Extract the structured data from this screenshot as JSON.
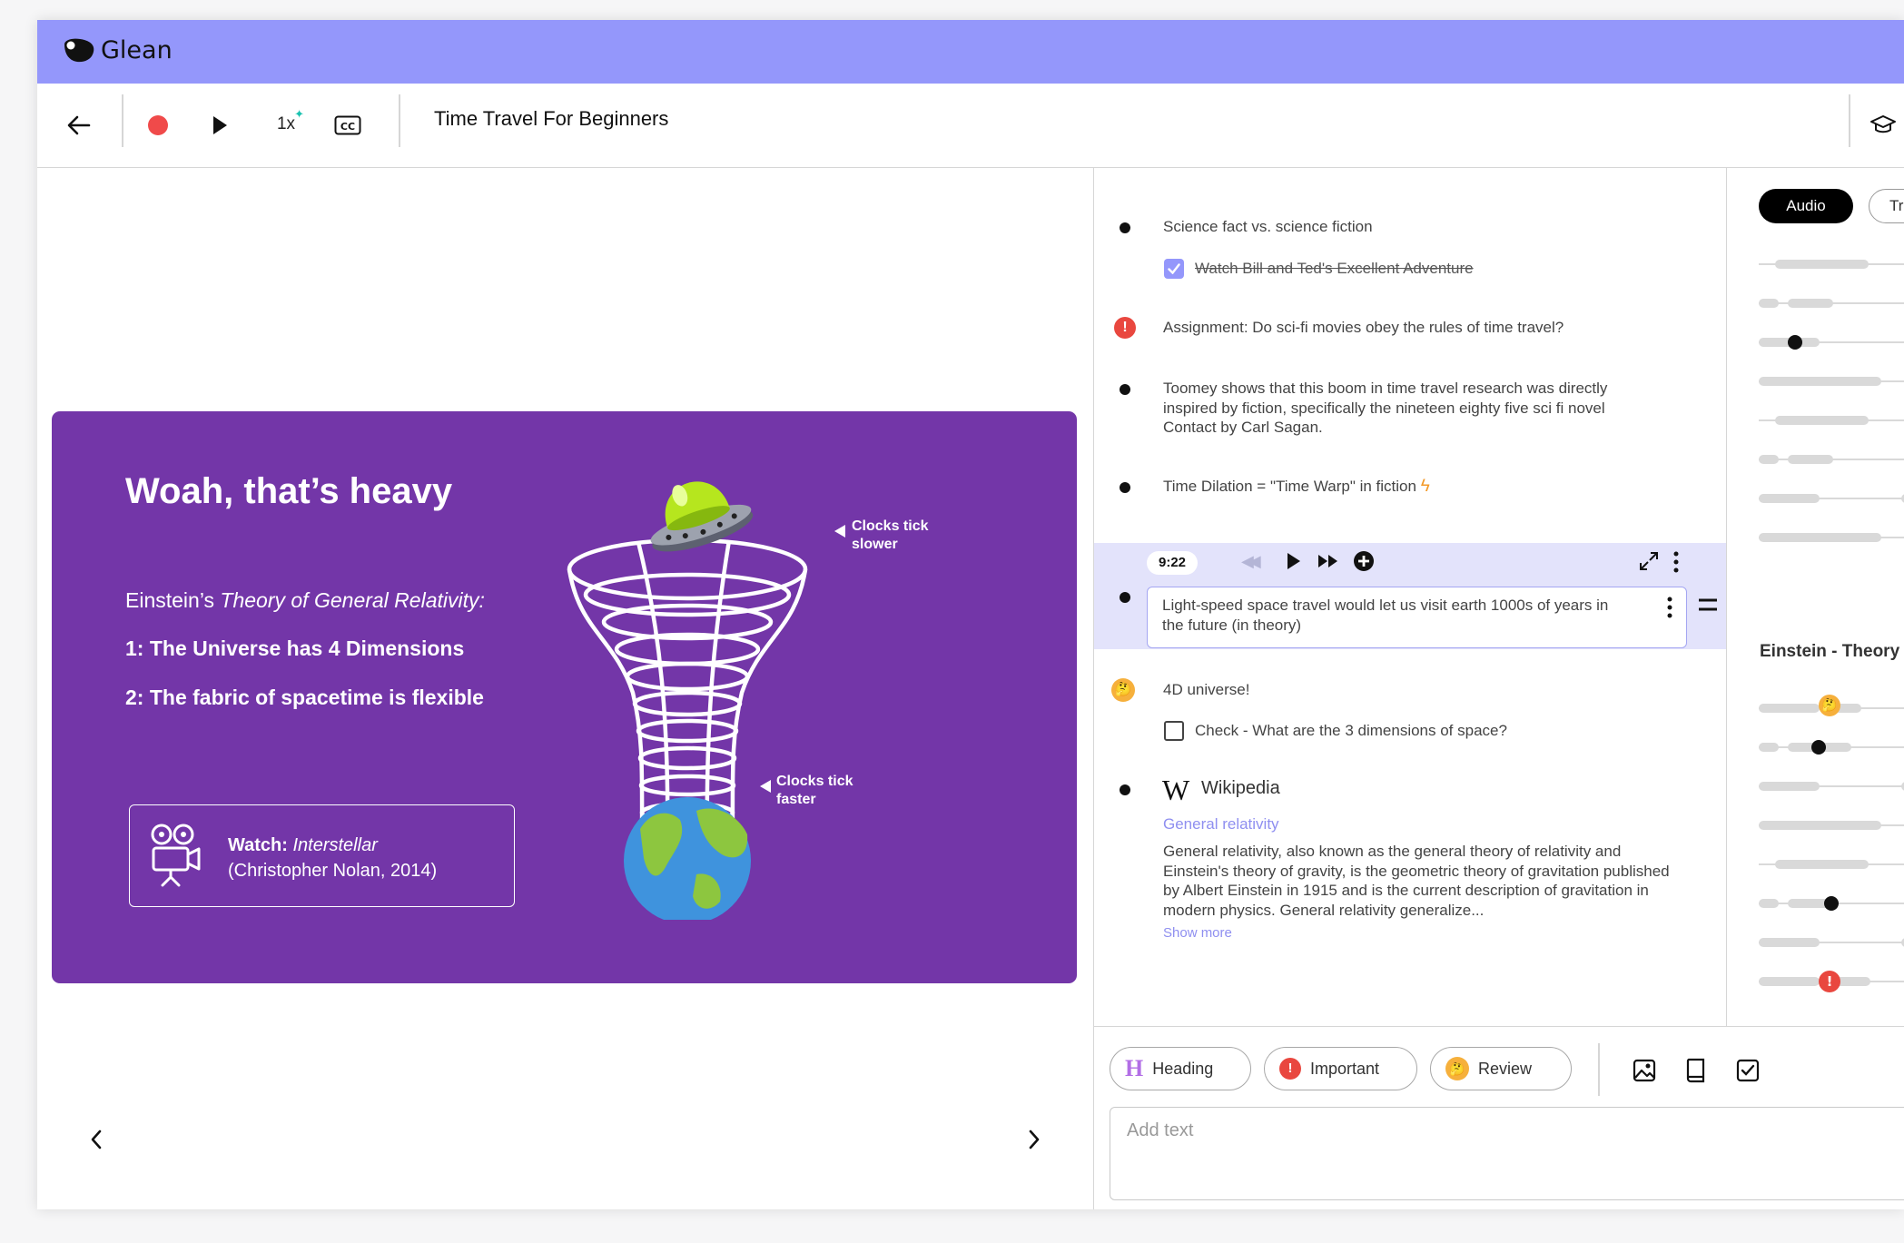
{
  "app": {
    "name": "Glean"
  },
  "toolbar": {
    "title": "Time Travel For Beginners",
    "speed": "1x",
    "cc": "CC"
  },
  "slide": {
    "title": "Woah, that’s heavy",
    "subtitle_prefix": "Einstein’s ",
    "subtitle_em": "Theory of General Relativity:",
    "point1": "1: The Universe has 4 Dimensions",
    "point2": "2: The fabric of spacetime is flexible",
    "watch_label": "Watch: ",
    "watch_title": "Interstellar",
    "watch_meta": "(Christopher Nolan, 2014)",
    "clocks_slower_1": "Clocks tick",
    "clocks_slower_2": "slower",
    "clocks_faster_1": "Clocks tick",
    "clocks_faster_2": "faster"
  },
  "notes": {
    "n1": "Science fact vs. science fiction",
    "n1_task": "Watch Bill and Ted's Excellent Adventure",
    "n2": "Assignment: Do sci-fi movies obey the rules of time travel?",
    "n3": "Toomey shows that this boom in time travel research was directly inspired by fiction, specifically the nineteen eighty five sci fi novel Contact by Carl Sagan.",
    "n4": "Time Dilation = \"Time Warp\" in fiction",
    "active_time": "9:22",
    "active_text": "Light-speed space travel would let us visit earth 1000s of years in the future (in theory)",
    "n6": "4D universe!",
    "n6_task": "Check - What are the 3 dimensions of space?",
    "wiki_source": "Wikipedia",
    "wiki_link": "General relativity",
    "wiki_text": "General relativity, also known as the general theory of relativity and Einstein's theory of gravity, is the geometric theory of gravitation published by Albert Einstein in 1915 and is the current description of gravitation in modern physics. General relativity generalize...",
    "show_more": "Show more"
  },
  "right_panel": {
    "tab_audio": "Audio",
    "tab_transcript": "Tra",
    "section_title": "Einstein - Theory"
  },
  "bottom": {
    "chip_heading": "Heading",
    "chip_important": "Important",
    "chip_review": "Review",
    "placeholder": "Add text"
  },
  "colors": {
    "accent": "#9497fb",
    "slide_bg": "#7336a8",
    "record": "#f04a4a",
    "important": "#e9473f",
    "link": "#8f8ff0"
  }
}
